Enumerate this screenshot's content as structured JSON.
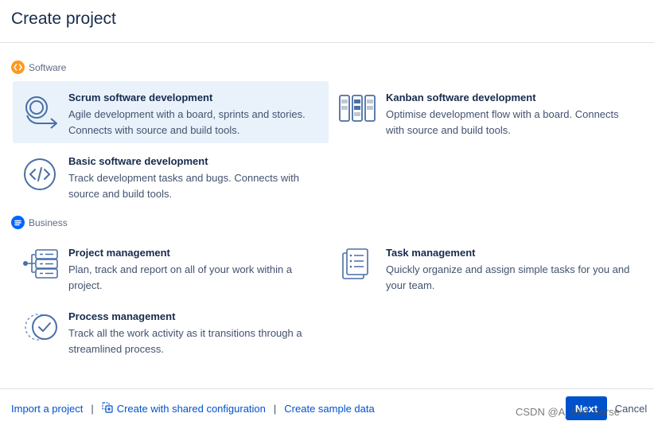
{
  "header": {
    "title": "Create project"
  },
  "sections": {
    "software": {
      "label": "Software",
      "badge_color": "#ff991f"
    },
    "business": {
      "label": "Business",
      "badge_color": "#0065ff"
    }
  },
  "templates": {
    "scrum": {
      "title": "Scrum software development",
      "description": "Agile development with a board, sprints and stories. Connects with source and build tools.",
      "icon": "scrum-icon",
      "selected": true
    },
    "kanban": {
      "title": "Kanban software development",
      "description": "Optimise development flow with a board. Connects with source and build tools.",
      "icon": "kanban-board-icon"
    },
    "basic": {
      "title": "Basic software development",
      "description": "Track development tasks and bugs. Connects with source and build tools.",
      "icon": "code-icon"
    },
    "project_mgmt": {
      "title": "Project management",
      "description": "Plan, track and report on all of your work within a project.",
      "icon": "project-management-icon"
    },
    "task_mgmt": {
      "title": "Task management",
      "description": "Quickly organize and assign simple tasks for you and your team.",
      "icon": "task-list-icon"
    },
    "process_mgmt": {
      "title": "Process management",
      "description": "Track all the work activity as it transitions through a streamlined process.",
      "icon": "process-check-icon"
    }
  },
  "footer": {
    "import_link": "Import a project",
    "shared_config_link": "Create with shared configuration",
    "sample_data_link": "Create sample data",
    "separator": "|",
    "next_label": "Next",
    "cancel_label": "Cancel",
    "watermark": "CSDN @A_bad_horse"
  },
  "colors": {
    "primary": "#0052cc",
    "selected_bg": "#e9f2fb",
    "text": "#172b4d",
    "subtle_text": "#42526e",
    "icon_blue": "#4a6fa5"
  }
}
